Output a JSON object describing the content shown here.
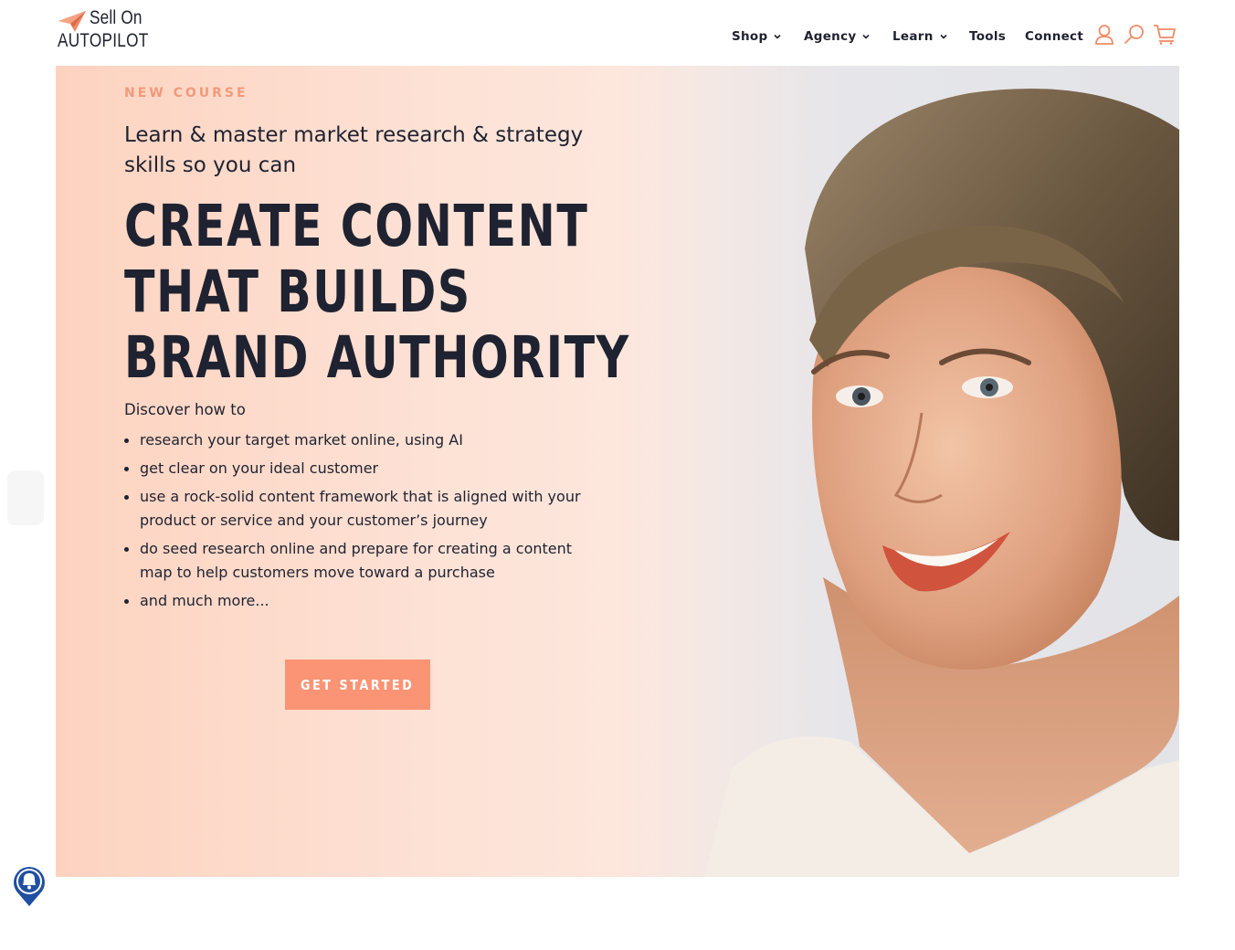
{
  "brand": {
    "line1": "Sell On",
    "line2": "AUTOPILOT",
    "accent_color": "#f08a66"
  },
  "nav": {
    "items": [
      {
        "label": "Shop",
        "has_dropdown": true
      },
      {
        "label": "Agency",
        "has_dropdown": true
      },
      {
        "label": "Learn",
        "has_dropdown": true
      },
      {
        "label": "Tools",
        "has_dropdown": false
      },
      {
        "label": "Connect",
        "has_dropdown": false
      }
    ],
    "icons": [
      "user-icon",
      "search-icon",
      "cart-icon"
    ]
  },
  "hero": {
    "eyebrow": "NEW COURSE",
    "intro": "Learn & master market research & strategy skills so you can",
    "headline": [
      "CREATE CONTENT",
      "THAT BUILDS",
      "BRAND AUTHORITY"
    ],
    "discover": "Discover how to",
    "bullets": [
      "research your target market online, using AI",
      "get clear on your ideal customer",
      "use a rock-solid content framework that is aligned with your product or service and your customer’s journey",
      "do seed research online and prepare for creating a content map to help customers move toward a purchase",
      "and much more..."
    ],
    "cta_label": "GET STARTED",
    "cta_color": "#fa9474",
    "image": "smiling-woman-portrait"
  },
  "widgets": {
    "bell_icon": "notification-bell-icon",
    "bell_color": "#1f4fa0"
  }
}
